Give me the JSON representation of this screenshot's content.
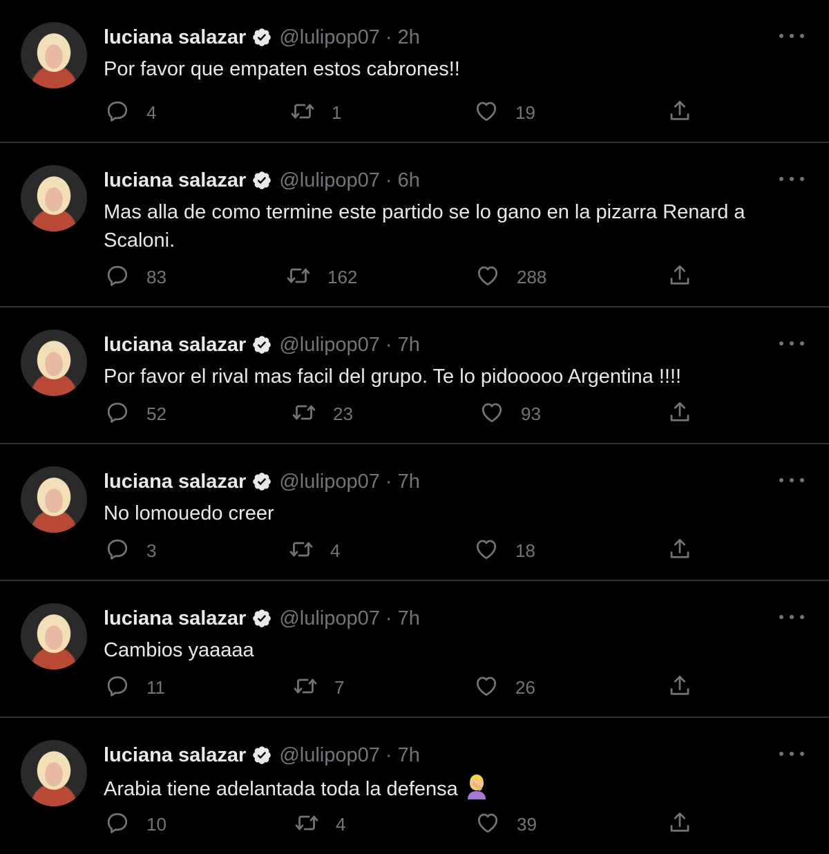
{
  "tweets": [
    {
      "name": "luciana salazar",
      "handle": "@lulipop07",
      "dot": "·",
      "time": "2h",
      "text": "Por favor que empaten estos cabrones!!",
      "replies": "4",
      "retweets": "1",
      "likes": "19",
      "emoji": ""
    },
    {
      "name": "luciana salazar",
      "handle": "@lulipop07",
      "dot": "·",
      "time": "6h",
      "text": "Mas alla de como termine este partido se lo gano en la pizarra Renard a Scaloni.",
      "replies": "83",
      "retweets": "162",
      "likes": "288",
      "emoji": ""
    },
    {
      "name": "luciana salazar",
      "handle": "@lulipop07",
      "dot": "·",
      "time": "7h",
      "text": "Por favor el rival mas facil del grupo. Te lo pidooooo Argentina !!!!",
      "replies": "52",
      "retweets": "23",
      "likes": "93",
      "emoji": ""
    },
    {
      "name": "luciana salazar",
      "handle": "@lulipop07",
      "dot": "·",
      "time": "7h",
      "text": "No lomouedo creer",
      "replies": "3",
      "retweets": "4",
      "likes": "18",
      "emoji": ""
    },
    {
      "name": "luciana salazar",
      "handle": "@lulipop07",
      "dot": "·",
      "time": "7h",
      "text": "Cambios yaaaaa",
      "replies": "11",
      "retweets": "7",
      "likes": "26",
      "emoji": ""
    },
    {
      "name": "luciana salazar",
      "handle": "@lulipop07",
      "dot": "·",
      "time": "7h",
      "text": "Arabia tiene adelantada toda la defensa",
      "replies": "10",
      "retweets": "4",
      "likes": "39",
      "emoji": "woman-facepalming-emoji"
    }
  ],
  "colors": {
    "background": "#000000",
    "text": "#e7e9ea",
    "muted": "#71767b",
    "divider": "#2f3336"
  },
  "icons": [
    "verified-badge-icon",
    "more-icon",
    "reply-icon",
    "retweet-icon",
    "like-icon",
    "share-icon"
  ]
}
